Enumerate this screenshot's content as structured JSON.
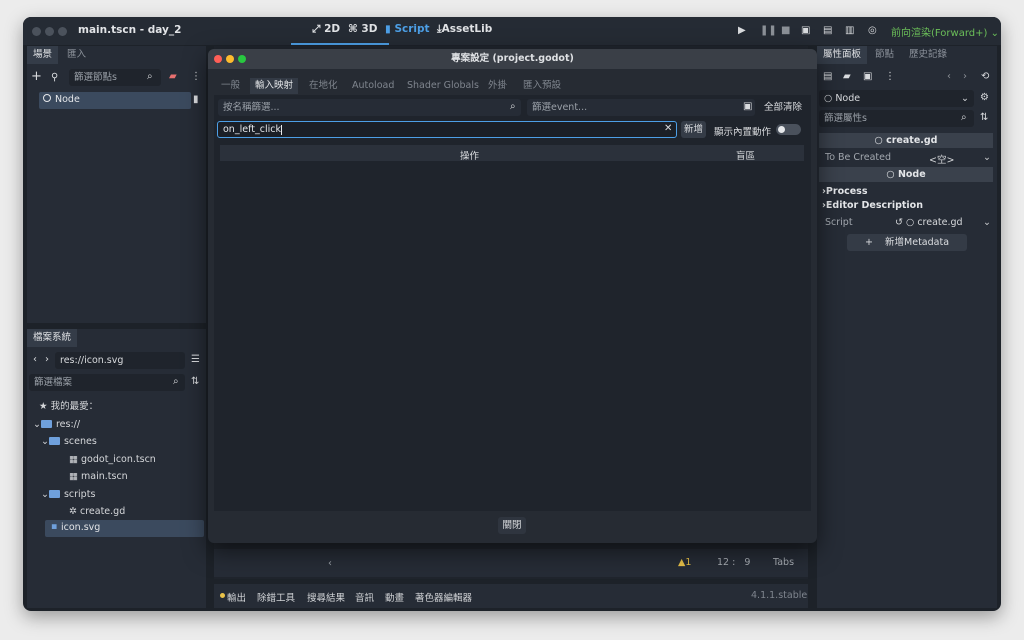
{
  "window": {
    "title": "main.tscn - day_2"
  },
  "workspace_tabs": [
    {
      "label": "2D"
    },
    {
      "label": "3D"
    },
    {
      "label": "Script"
    },
    {
      "label": "AssetLib"
    }
  ],
  "renderer_label": "前向渲染(Forward+)",
  "accent_color": "#4d9fe6",
  "scene_panel": {
    "tabs": [
      "場景",
      "匯入"
    ],
    "filter_placeholder": "篩選節點s",
    "root_node": "Node"
  },
  "filesystem_panel": {
    "tab": "檔案系統",
    "path": "res://icon.svg",
    "filter_placeholder": "篩選檔案",
    "favorites": "我的最愛：",
    "tree": [
      {
        "label": "res://",
        "kind": "folder"
      },
      {
        "label": "scenes",
        "kind": "folder"
      },
      {
        "label": "godot_icon.tscn",
        "kind": "scene"
      },
      {
        "label": "main.tscn",
        "kind": "scene"
      },
      {
        "label": "scripts",
        "kind": "folder"
      },
      {
        "label": "create.gd",
        "kind": "script"
      },
      {
        "label": "icon.svg",
        "kind": "image"
      }
    ]
  },
  "inspector": {
    "tabs": [
      "屬性面板",
      "節點",
      "歷史記錄"
    ],
    "node_selector": "Node",
    "filter_placeholder": "篩選屬性s",
    "script_header": "create.gd",
    "to_be_created_label": "To Be Created",
    "to_be_created_value": "<空>",
    "node_header": "Node",
    "process_label": "Process",
    "editor_description_label": "Editor Description",
    "script_label": "Script",
    "script_value": "create.gd",
    "add_metadata": "新增Metadata"
  },
  "dialog": {
    "title": "專案設定 (project.godot)",
    "tabs": [
      "一般",
      "輸入映射",
      "在地化",
      "Autoload",
      "Shader Globals",
      "外掛",
      "匯入預設"
    ],
    "filter_name_placeholder": "按名稱篩選...",
    "filter_event_placeholder": "篩選event...",
    "clear_all": "全部清除",
    "action_input_value": "on_left_click",
    "add_button": "新增",
    "show_builtin": "顯示內置動作",
    "col_action": "操作",
    "col_deadzone": "盲區",
    "close_button": "關閉"
  },
  "script_status": {
    "warnings": "1",
    "line": "12",
    "col": "9",
    "indent": "Tabs"
  },
  "bottom_panel": {
    "tabs": [
      "輸出",
      "除錯工具",
      "搜尋結果",
      "音訊",
      "動畫",
      "著色器編輯器"
    ],
    "version": "4.1.1.stable"
  }
}
